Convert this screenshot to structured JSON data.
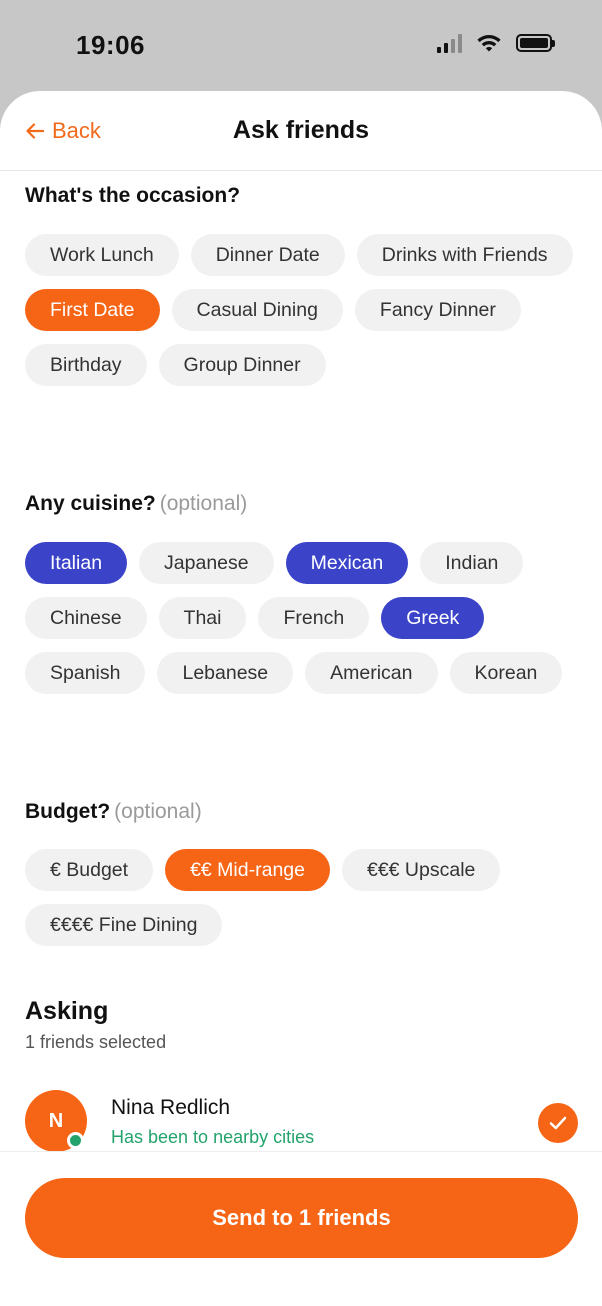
{
  "status_bar": {
    "time": "19:06"
  },
  "nav": {
    "back_label": "Back",
    "title": "Ask friends"
  },
  "occasion": {
    "heading": "What's the occasion?",
    "options": [
      "Work Lunch",
      "Dinner Date",
      "Drinks with Friends",
      "First Date",
      "Casual Dining",
      "Fancy Dinner",
      "Birthday",
      "Group Dinner"
    ],
    "selected": [
      "First Date"
    ]
  },
  "cuisine": {
    "heading": "Any cuisine?",
    "optional_label": "(optional)",
    "options": [
      "Italian",
      "Japanese",
      "Mexican",
      "Indian",
      "Chinese",
      "Thai",
      "French",
      "Greek",
      "Spanish",
      "Lebanese",
      "American",
      "Korean"
    ],
    "selected": [
      "Italian",
      "Mexican",
      "Greek"
    ]
  },
  "budget": {
    "heading": "Budget?",
    "optional_label": "(optional)",
    "options": [
      "€ Budget",
      "€€ Mid-range",
      "€€€ Upscale",
      "€€€€ Fine Dining"
    ],
    "selected": [
      "€€ Mid-range"
    ]
  },
  "asking": {
    "title": "Asking",
    "subtitle": "1 friends selected",
    "friends": [
      {
        "initial": "N",
        "name": "Nina Redlich",
        "note": "Has been to nearby cities",
        "online": true,
        "selected": true
      }
    ]
  },
  "footer": {
    "send_label": "Send to 1 friends"
  },
  "colors": {
    "accent_orange": "#f66415",
    "accent_blue": "#3b44c9",
    "online_green": "#23a36b",
    "chip_bg": "#f1f1f1"
  }
}
